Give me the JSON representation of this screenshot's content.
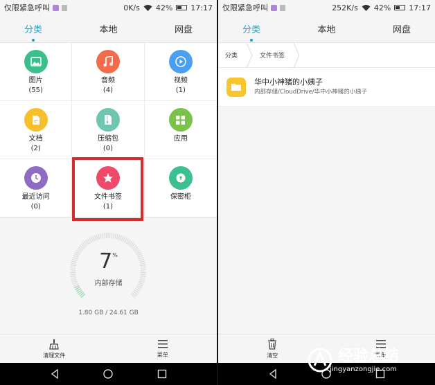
{
  "left": {
    "status": {
      "carrier": "仅限紧急呼叫",
      "speed": "0K/s",
      "battery": "42%",
      "time": "17:17"
    },
    "tabs": [
      {
        "label": "分类",
        "active": true
      },
      {
        "label": "本地",
        "active": false
      },
      {
        "label": "网盘",
        "active": false
      }
    ],
    "categories": [
      {
        "label": "图片",
        "count": "(55)",
        "color": "#3cbf8a",
        "icon": "image-icon"
      },
      {
        "label": "音频",
        "count": "(4)",
        "color": "#f26b4a",
        "icon": "music-icon"
      },
      {
        "label": "视频",
        "count": "(1)",
        "color": "#4a9ff0",
        "icon": "video-play-icon"
      },
      {
        "label": "文档",
        "count": "(2)",
        "color": "#f7bf2d",
        "icon": "document-icon"
      },
      {
        "label": "压缩包",
        "count": "(0)",
        "color": "#6fc6b0",
        "icon": "zip-icon"
      },
      {
        "label": "应用",
        "count": "",
        "color": "#7bc24a",
        "icon": "apps-grid-icon"
      },
      {
        "label": "最近访问",
        "count": "(0)",
        "color": "#8e6cc4",
        "icon": "clock-icon"
      },
      {
        "label": "文件书签",
        "count": "(1)",
        "color": "#ef4a6a",
        "icon": "star-icon"
      },
      {
        "label": "保密柜",
        "count": "",
        "color": "#3cc08f",
        "icon": "safe-icon"
      }
    ],
    "storage": {
      "percent": "7",
      "percent_sign": "%",
      "label": "内部存储",
      "size": "1.80 GB / 24.61 GB",
      "fraction": 0.07
    },
    "bottom": {
      "clean_label": "清理文件",
      "menu_label": "菜单"
    }
  },
  "right": {
    "status": {
      "carrier": "仅限紧急呼叫",
      "speed": "252K/s",
      "battery": "42%",
      "time": "17:17"
    },
    "tabs": [
      {
        "label": "分类",
        "active": true
      },
      {
        "label": "本地",
        "active": false
      },
      {
        "label": "网盘",
        "active": false
      }
    ],
    "breadcrumb": [
      "分类",
      "文件书签"
    ],
    "file": {
      "name": "华中小神猪的小姨子",
      "path": "内部存储/CloudDrive/华中小神猪的小姨子"
    },
    "bottom": {
      "clear_label": "清空",
      "menu_label": "菜单"
    }
  },
  "watermark": {
    "text": "经验总结",
    "url": "jingyanzongjie.com"
  },
  "colors": {
    "accent": "#1aa3c8",
    "highlight": "#d32d2d",
    "folder": "#f7c52e"
  }
}
